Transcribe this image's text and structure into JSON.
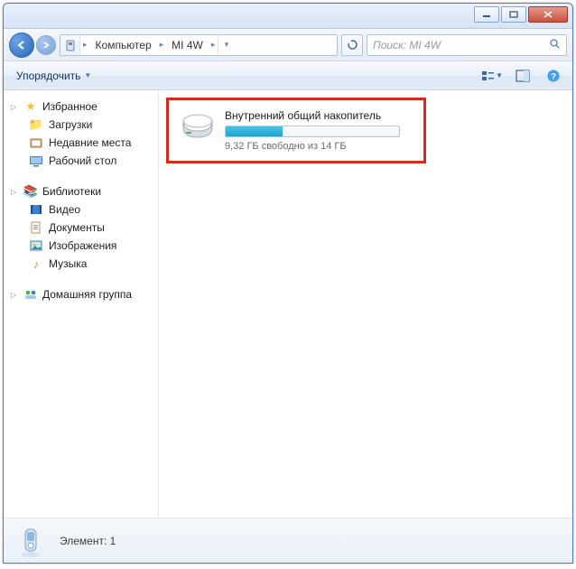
{
  "breadcrumb": {
    "seg1": "Компьютер",
    "seg2": "MI 4W"
  },
  "search": {
    "placeholder": "Поиск: MI 4W"
  },
  "toolbar": {
    "organize": "Упорядочить"
  },
  "sidebar": {
    "favorites": {
      "label": "Избранное",
      "items": [
        "Загрузки",
        "Недавние места",
        "Рабочий стол"
      ]
    },
    "libraries": {
      "label": "Библиотеки",
      "items": [
        "Видео",
        "Документы",
        "Изображения",
        "Музыка"
      ]
    },
    "homegroup": {
      "label": "Домашняя группа"
    }
  },
  "drive": {
    "title": "Внутренний общий накопитель",
    "subtitle": "9,32 ГБ свободно из 14 ГБ",
    "used_percent": 33
  },
  "status": {
    "text": "Элемент: 1"
  }
}
